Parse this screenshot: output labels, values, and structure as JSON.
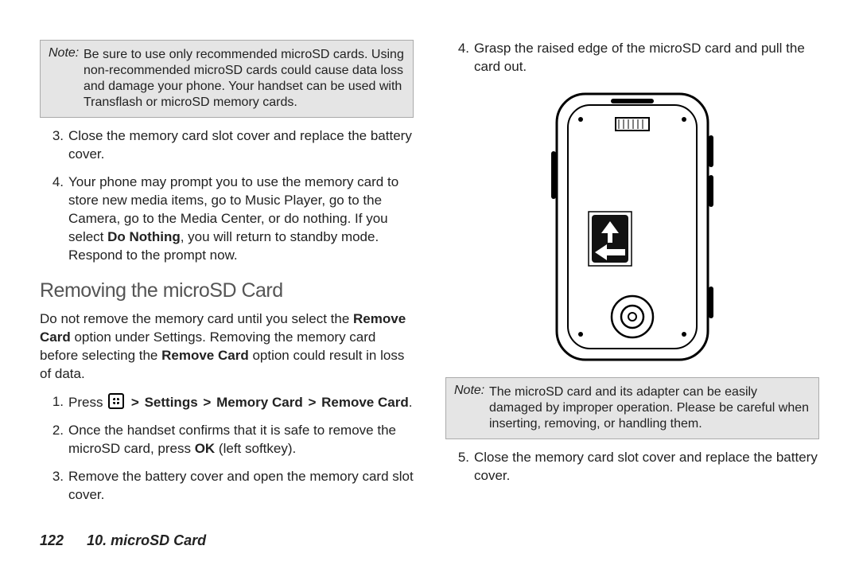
{
  "left": {
    "note_label": "Note:",
    "note_body": "Be sure to use only recommended microSD cards. Using non-recommended microSD cards could cause data loss and damage your phone. Your handset can be used with Transflash or microSD memory cards.",
    "step3_num": "3.",
    "step3": "Close the memory card slot cover and replace the battery cover.",
    "step4_num": "4.",
    "step4_a": "Your phone may prompt you to use the memory card to store new media items, go to Music Player, go to the Camera, go to the Media Center, or do nothing. If you select ",
    "step4_bold": "Do Nothing",
    "step4_b": ", you will return to standby mode. Respond to the prompt now.",
    "heading": "Removing the microSD Card",
    "intro_a": "Do not remove the memory card until you select the ",
    "intro_b1": "Remove Card",
    "intro_c": " option under Settings. Removing the memory card before selecting the ",
    "intro_b2": "Remove Card",
    "intro_d": " option could result in loss of data.",
    "r1_num": "1.",
    "r1_press": "Press ",
    "r1_settings": "Settings",
    "r1_memcard": "Memory Card",
    "r1_remove": "Remove Card",
    "r1_period": ".",
    "gt": ">",
    "r2_num": "2.",
    "r2_a": "Once the handset confirms that it is safe to remove the microSD card, press ",
    "r2_bold": "OK",
    "r2_b": " (left softkey).",
    "r3_num": "3.",
    "r3": "Remove the battery cover and open the memory card slot cover."
  },
  "right": {
    "step4_num": "4.",
    "step4": "Grasp the raised edge of the microSD card and pull the card out.",
    "note_label": "Note:",
    "note_body": "The microSD card and its adapter can be easily damaged by improper operation. Please be careful when inserting, removing, or handling them.",
    "step5_num": "5.",
    "step5": "Close the memory card slot cover and replace the battery cover."
  },
  "footer": {
    "page": "122",
    "section": "10. microSD Card"
  }
}
